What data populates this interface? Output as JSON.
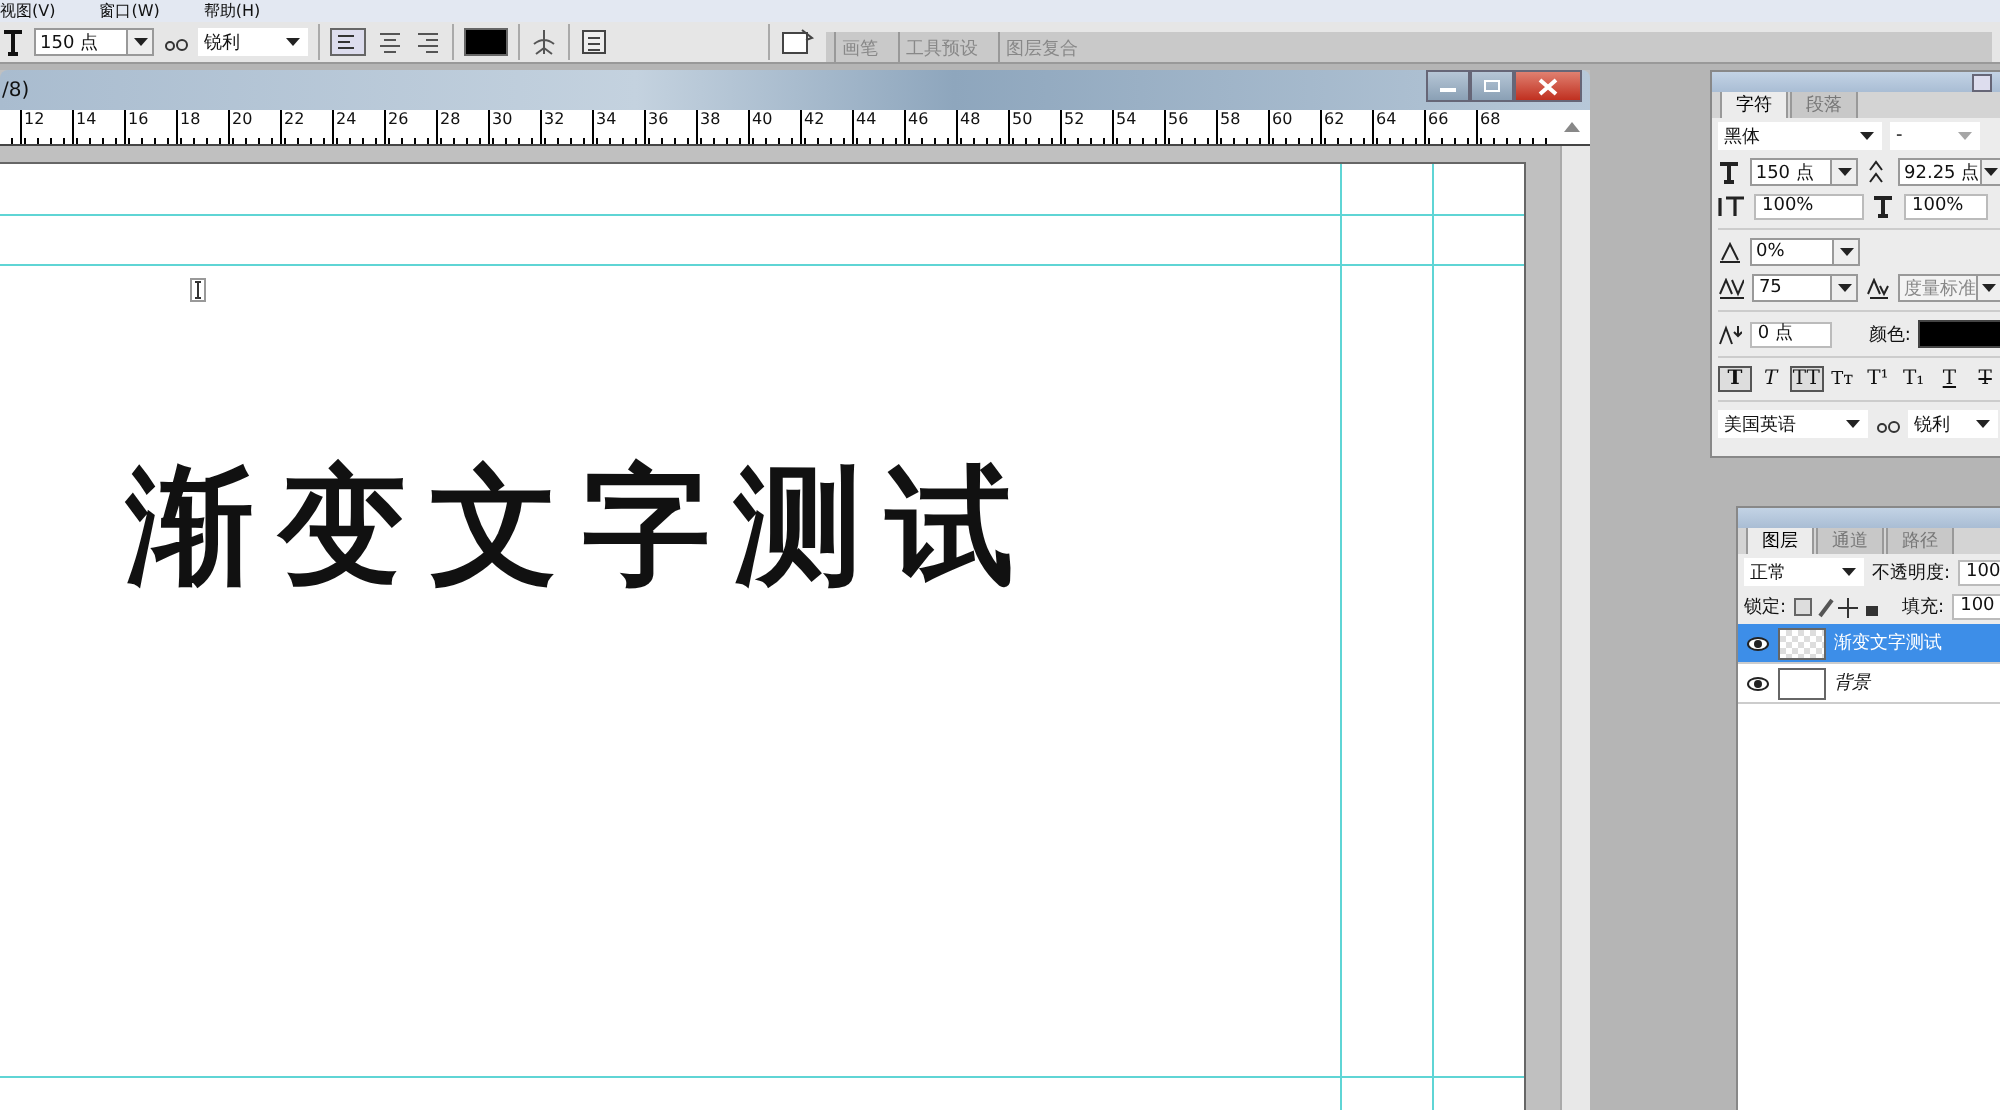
{
  "menu_bar": [
    "视图(V)",
    "窗口(W)",
    "帮助(H)"
  ],
  "options_bar": {
    "font_size": "150 点",
    "anti_alias": "锐利",
    "color": "#000000",
    "tabs": [
      {
        "label": "画笔"
      },
      {
        "label": "工具预设"
      },
      {
        "label": "图层复合"
      }
    ]
  },
  "document": {
    "title": "/8)",
    "ruler": [
      "12",
      "14",
      "16",
      "18",
      "20",
      "22",
      "24",
      "26",
      "28",
      "30",
      "32",
      "34",
      "36",
      "38",
      "40",
      "42",
      "44",
      "46",
      "48",
      "50",
      "52",
      "54",
      "56",
      "58",
      "60",
      "62",
      "64",
      "66",
      "68"
    ],
    "text": "渐变文字测试"
  },
  "character_panel": {
    "tabs": [
      {
        "label": "字符",
        "selected": true
      },
      {
        "label": "段落",
        "selected": false
      }
    ],
    "font_family": "黑体",
    "font_style": "-",
    "size": "150 点",
    "leading": "92.25 点",
    "vertical_scale": "100%",
    "horizontal_scale": "100%",
    "tsume": "0%",
    "tracking": "75",
    "kerning": "度量标准",
    "baseline_shift": "0 点",
    "color_label": "颜色:",
    "color": "#000000",
    "styles": [
      {
        "label": "T",
        "kind": "bold",
        "selected": true
      },
      {
        "label": "T",
        "kind": "italic",
        "selected": false
      },
      {
        "label": "TT",
        "kind": "caps",
        "selected": true
      },
      {
        "label": "Tт",
        "kind": "smallcaps",
        "selected": false
      },
      {
        "label": "T¹",
        "kind": "super",
        "selected": false
      },
      {
        "label": "T₁",
        "kind": "sub",
        "selected": false
      },
      {
        "label": "T",
        "kind": "underline",
        "selected": false
      },
      {
        "label": "T",
        "kind": "strike",
        "selected": false
      }
    ],
    "language": "美国英语",
    "anti_alias": "锐利"
  },
  "layers_panel": {
    "tabs": [
      {
        "label": "图层",
        "selected": true
      },
      {
        "label": "通道",
        "selected": false
      },
      {
        "label": "路径",
        "selected": false
      }
    ],
    "blend_mode": "正常",
    "opacity_label": "不透明度:",
    "opacity": "100",
    "lock_label": "锁定:",
    "fill_label": "填充:",
    "fill": "100",
    "layers": [
      {
        "name": "渐变文字测试",
        "kind": "text",
        "selected": true,
        "visible": true
      },
      {
        "name": "背景",
        "kind": "background",
        "selected": false,
        "visible": true
      }
    ]
  }
}
